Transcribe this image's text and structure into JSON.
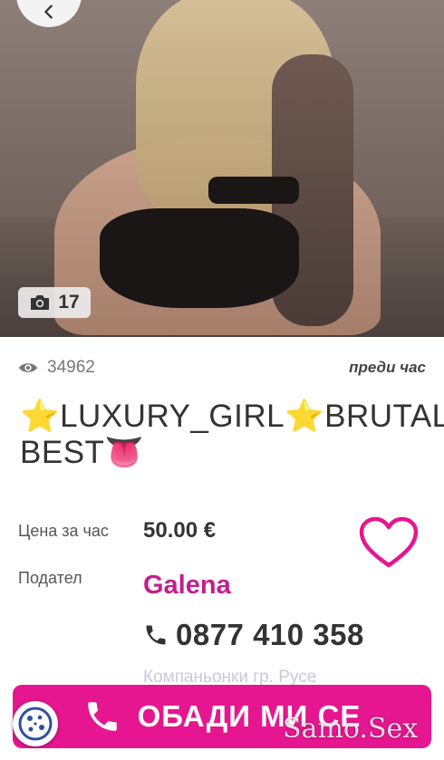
{
  "colors": {
    "accent": "#e5168f",
    "seller": "#c21f8c",
    "text_dark": "#333333",
    "text_muted": "#777777"
  },
  "gallery": {
    "photo_count": "17",
    "camera_icon": "camera-icon",
    "back_icon": "chevron-left-icon"
  },
  "listing": {
    "views": "34962",
    "posted": "преди час",
    "title": "⭐LUXURY_GIRL⭐BRUTAL\nBEST👅",
    "price_label": "Цена за час",
    "price_value": "50.00 €",
    "seller_label": "Подател",
    "seller_name": "Galena",
    "phone": "0877 410 358",
    "location": "Компаньонки гр. Русе"
  },
  "actions": {
    "call_label": "ОБАДИ МИ СЕ",
    "call_icon": "phone-icon",
    "favorite_icon": "heart-icon",
    "cookie_icon": "cookie-icon"
  },
  "watermark": "Samo.Sex"
}
